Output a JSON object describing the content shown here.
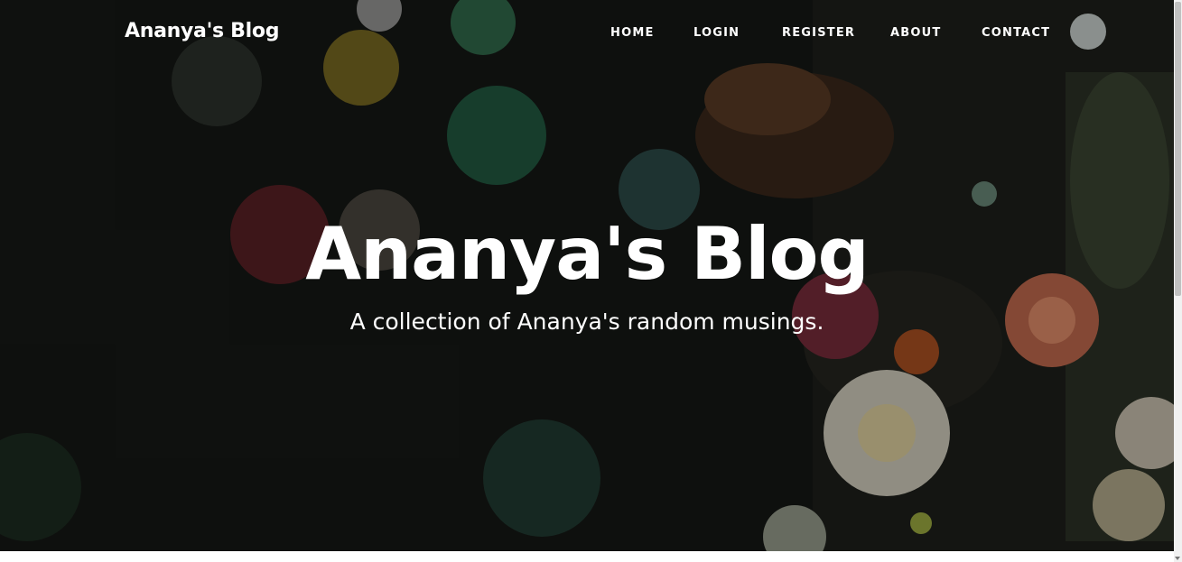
{
  "navbar": {
    "brand": "Ananya's Blog",
    "links": [
      "HOME",
      "LOGIN",
      "REGISTER",
      "ABOUT",
      "CONTACT"
    ]
  },
  "masthead": {
    "title": "Ananya's Blog",
    "subtitle": "A collection of Ananya's random musings."
  },
  "colors": {
    "text": "#ffffff",
    "background_dark": "#141612"
  }
}
